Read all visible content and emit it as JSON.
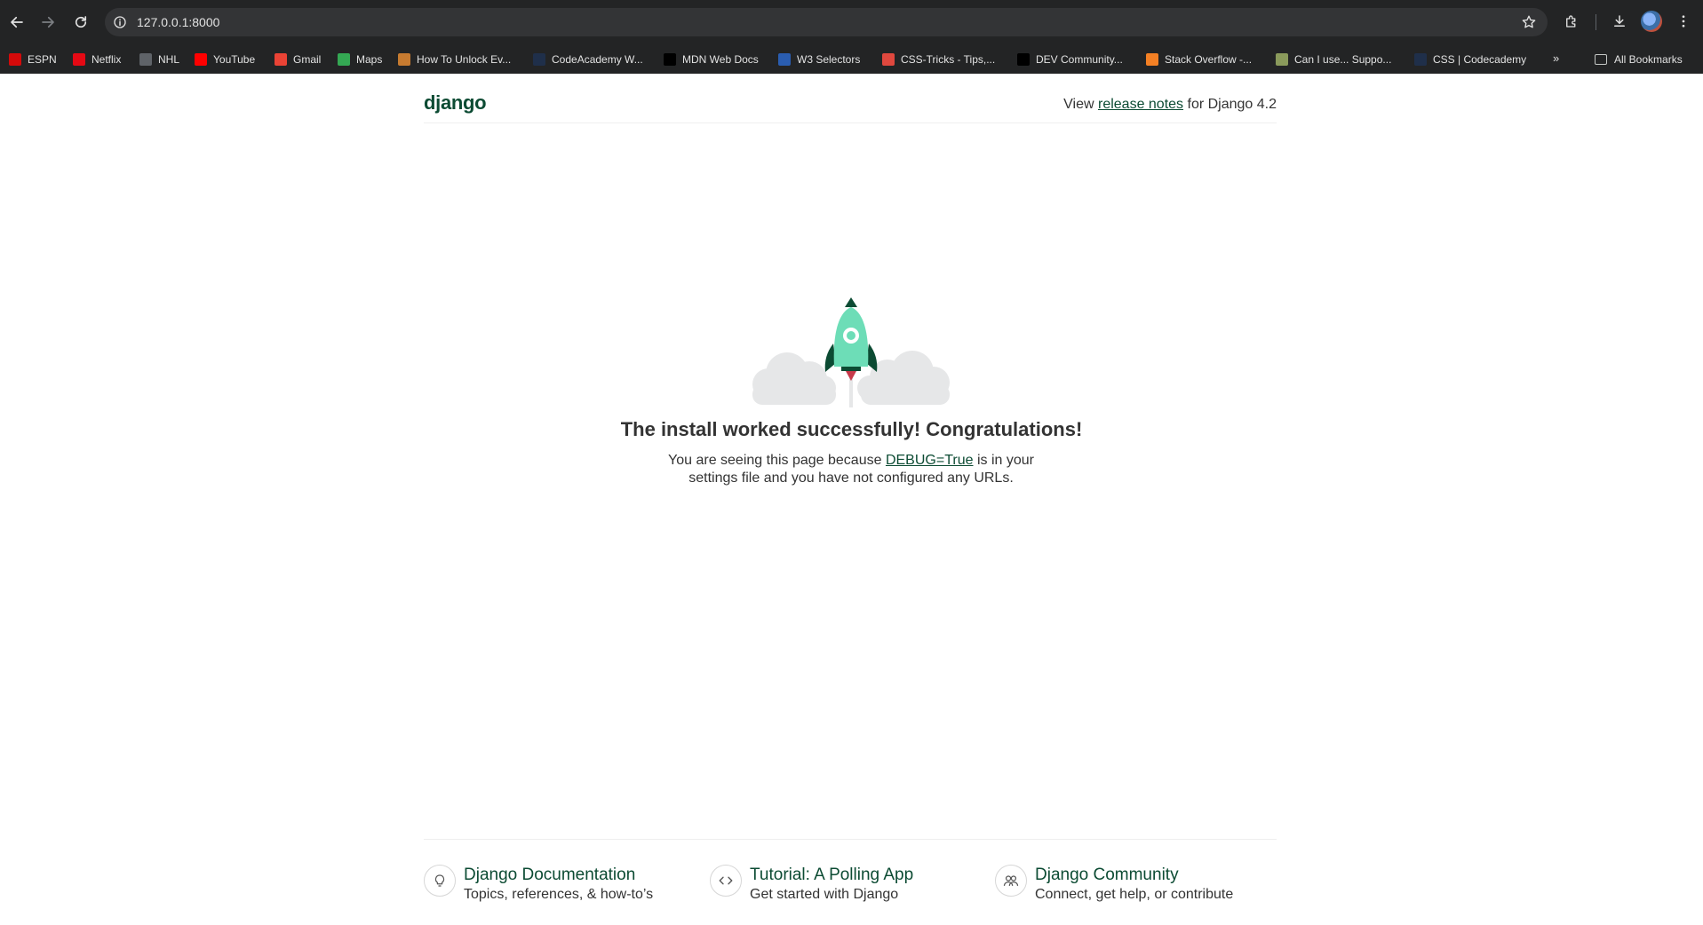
{
  "browser": {
    "url": "127.0.0.1:8000",
    "bookmarks": [
      {
        "label": "ESPN",
        "icon": "espn-icon",
        "color": "#d50a0a"
      },
      {
        "label": "Netflix",
        "icon": "netflix-icon",
        "color": "#e50914"
      },
      {
        "label": "NHL",
        "icon": "nhl-icon",
        "color": "#5f6368"
      },
      {
        "label": "YouTube",
        "icon": "youtube-icon",
        "color": "#ff0000"
      },
      {
        "label": "Gmail",
        "icon": "gmail-icon",
        "color": "#ea4335"
      },
      {
        "label": "Maps",
        "icon": "maps-icon",
        "color": "#34a853"
      },
      {
        "label": "How To Unlock Ev...",
        "icon": "puzzle-icon",
        "color": "#c77b30"
      },
      {
        "label": "CodeAcademy W...",
        "icon": "codecademy-icon",
        "color": "#1f2f4a"
      },
      {
        "label": "MDN Web Docs",
        "icon": "mdn-icon",
        "color": "#000000"
      },
      {
        "label": "W3 Selectors",
        "icon": "w3-icon",
        "color": "#2a5db0"
      },
      {
        "label": "CSS-Tricks - Tips,...",
        "icon": "css-tricks-icon",
        "color": "#e0483e"
      },
      {
        "label": "DEV Community...",
        "icon": "dev-icon",
        "color": "#000000"
      },
      {
        "label": "Stack Overflow -...",
        "icon": "stackoverflow-icon",
        "color": "#f48024"
      },
      {
        "label": "Can I use... Suppo...",
        "icon": "caniuse-icon",
        "color": "#8a9a5b"
      },
      {
        "label": "CSS | Codecademy",
        "icon": "codecademy-icon",
        "color": "#1f2f4a"
      }
    ],
    "more_label": "»",
    "all_bookmarks_label": "All Bookmarks"
  },
  "header": {
    "logo": "django",
    "release_prefix": "View ",
    "release_link": "release notes",
    "release_suffix": " for Django 4.2"
  },
  "main": {
    "headline": "The install worked successfully! Congratulations!",
    "sub_prefix": "You are seeing this page because ",
    "sub_link": "DEBUG=True",
    "sub_suffix": " is in your settings file and you have not configured any URLs."
  },
  "footer": {
    "cards": [
      {
        "title": "Django Documentation",
        "desc": "Topics, references, & how-to’s",
        "icon": "lightbulb-icon"
      },
      {
        "title": "Tutorial: A Polling App",
        "desc": "Get started with Django",
        "icon": "code-icon"
      },
      {
        "title": "Django Community",
        "desc": "Connect, get help, or contribute",
        "icon": "people-icon"
      }
    ]
  },
  "colors": {
    "chrome_bg": "#232425",
    "brand_green": "#0c4b33",
    "rocket_teal": "#6dddb7"
  }
}
